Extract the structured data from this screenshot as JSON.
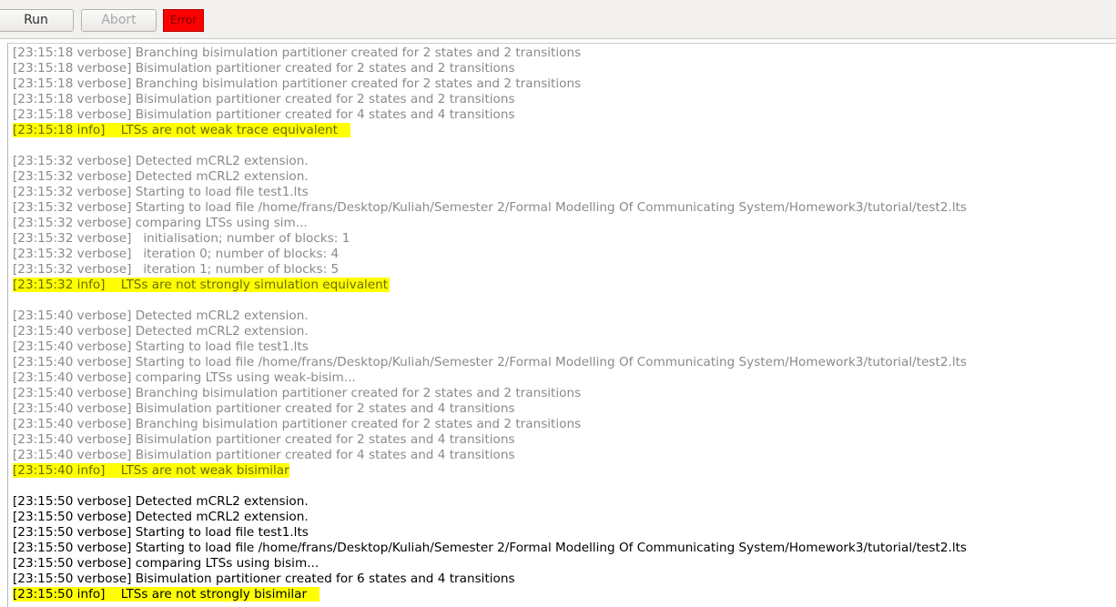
{
  "toolbar": {
    "run_label": "Run",
    "abort_label": "Abort",
    "status_label": "Error"
  },
  "log": {
    "groups": [
      {
        "style": "grey",
        "lines": [
          "[23:15:18 verbose] Branching bisimulation partitioner created for 2 states and 2 transitions",
          "[23:15:18 verbose] Bisimulation partitioner created for 2 states and 2 transitions",
          "[23:15:18 verbose] Branching bisimulation partitioner created for 2 states and 2 transitions",
          "[23:15:18 verbose] Bisimulation partitioner created for 2 states and 2 transitions",
          "[23:15:18 verbose] Bisimulation partitioner created for 4 states and 4 transitions"
        ],
        "result": "[23:15:18 info]    LTSs are not weak trace equivalent"
      },
      {
        "style": "grey",
        "lines": [
          "[23:15:32 verbose] Detected mCRL2 extension.",
          "[23:15:32 verbose] Detected mCRL2 extension.",
          "[23:15:32 verbose] Starting to load file test1.lts",
          "[23:15:32 verbose] Starting to load file /home/frans/Desktop/Kuliah/Semester 2/Formal Modelling Of Communicating System/Homework3/tutorial/test2.lts",
          "[23:15:32 verbose] comparing LTSs using sim...",
          "[23:15:32 verbose]   initialisation; number of blocks: 1",
          "[23:15:32 verbose]   iteration 0; number of blocks: 4",
          "[23:15:32 verbose]   iteration 1; number of blocks: 5"
        ],
        "result": "[23:15:32 info]    LTSs are not strongly simulation equivalent"
      },
      {
        "style": "grey",
        "lines": [
          "[23:15:40 verbose] Detected mCRL2 extension.",
          "[23:15:40 verbose] Detected mCRL2 extension.",
          "[23:15:40 verbose] Starting to load file test1.lts",
          "[23:15:40 verbose] Starting to load file /home/frans/Desktop/Kuliah/Semester 2/Formal Modelling Of Communicating System/Homework3/tutorial/test2.lts",
          "[23:15:40 verbose] comparing LTSs using weak-bisim...",
          "[23:15:40 verbose] Branching bisimulation partitioner created for 2 states and 2 transitions",
          "[23:15:40 verbose] Bisimulation partitioner created for 2 states and 4 transitions",
          "[23:15:40 verbose] Branching bisimulation partitioner created for 2 states and 2 transitions",
          "[23:15:40 verbose] Bisimulation partitioner created for 2 states and 4 transitions",
          "[23:15:40 verbose] Bisimulation partitioner created for 4 states and 4 transitions"
        ],
        "result": "[23:15:40 info]    LTSs are not weak bisimilar"
      },
      {
        "style": "black",
        "lines": [
          "[23:15:50 verbose] Detected mCRL2 extension.",
          "[23:15:50 verbose] Detected mCRL2 extension.",
          "[23:15:50 verbose] Starting to load file test1.lts",
          "[23:15:50 verbose] Starting to load file /home/frans/Desktop/Kuliah/Semester 2/Formal Modelling Of Communicating System/Homework3/tutorial/test2.lts",
          "[23:15:50 verbose] comparing LTSs using bisim...",
          "[23:15:50 verbose] Bisimulation partitioner created for 6 states and 4 transitions"
        ],
        "result": "[23:15:50 info]    LTSs are not strongly bisimilar"
      }
    ]
  },
  "colors": {
    "highlight": "#ffff00",
    "error": "#ff0000",
    "old_text": "#8a8a8a",
    "new_text": "#000000"
  }
}
